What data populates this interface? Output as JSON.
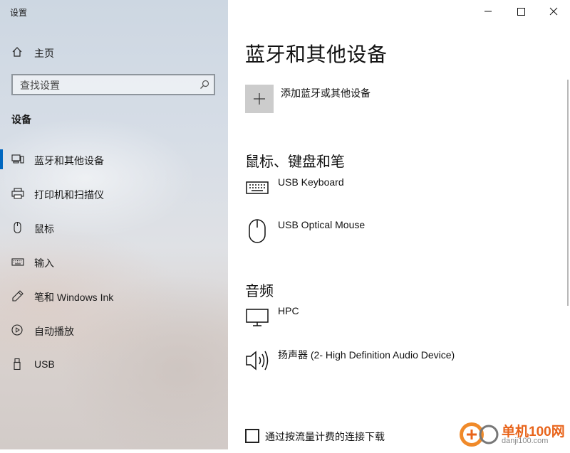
{
  "window": {
    "title": "设置",
    "controls": {
      "minimize": "minimize",
      "maximize": "maximize",
      "close": "close"
    }
  },
  "sidebar": {
    "home_label": "主页",
    "search_placeholder": "查找设置",
    "section_title": "设备",
    "items": [
      {
        "label": "蓝牙和其他设备",
        "icon": "bluetooth-devices-icon",
        "active": true
      },
      {
        "label": "打印机和扫描仪",
        "icon": "printer-icon",
        "active": false
      },
      {
        "label": "鼠标",
        "icon": "mouse-icon",
        "active": false
      },
      {
        "label": "输入",
        "icon": "keyboard-icon",
        "active": false
      },
      {
        "label": "笔和 Windows Ink",
        "icon": "pen-icon",
        "active": false
      },
      {
        "label": "自动播放",
        "icon": "autoplay-icon",
        "active": false
      },
      {
        "label": "USB",
        "icon": "usb-icon",
        "active": false
      }
    ]
  },
  "main": {
    "title": "蓝牙和其他设备",
    "add_device_label": "添加蓝牙或其他设备",
    "groups": [
      {
        "title": "鼠标、键盘和笔",
        "devices": [
          {
            "name": "USB Keyboard",
            "icon": "keyboard-icon"
          },
          {
            "name": "USB Optical Mouse",
            "icon": "mouse-icon"
          }
        ]
      },
      {
        "title": "音频",
        "devices": [
          {
            "name": "HPC",
            "icon": "monitor-icon"
          },
          {
            "name": "扬声器 (2- High Definition Audio Device)",
            "icon": "speaker-icon"
          }
        ]
      }
    ],
    "metered_label": "通过按流量计费的连接下载",
    "metered_checked": false
  },
  "watermark": {
    "name": "单机100网",
    "url": "danji100.com"
  },
  "colors": {
    "accent": "#0067c0",
    "watermark": "#e8641b"
  }
}
